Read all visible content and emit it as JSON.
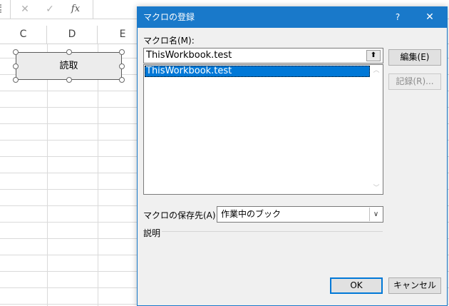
{
  "excel": {
    "formula_bar": {
      "cancel_icon": "✕",
      "enter_icon": "✓",
      "fx_label": "fx"
    },
    "columns": [
      "C",
      "D",
      "E"
    ],
    "shape_label": "読取"
  },
  "dialog": {
    "title": "マクロの登録",
    "help_label": "?",
    "close_label": "✕",
    "macro_name_label": "マクロ名(M):",
    "macro_name_value": "ThisWorkbook.test",
    "upload_icon": "⬆",
    "list_items": [
      "ThisWorkbook.test"
    ],
    "edit_button": "編集(E)",
    "record_button": "記録(R)...",
    "store_in_label": "マクロの保存先(A):",
    "store_in_value": "作業中のブック",
    "description_label": "説明",
    "ok_button": "OK",
    "cancel_button": "キャンセル"
  },
  "colors": {
    "title_bar": "#1979ca",
    "selection": "#0078d7",
    "dialog_bg": "#f0f0f0"
  }
}
